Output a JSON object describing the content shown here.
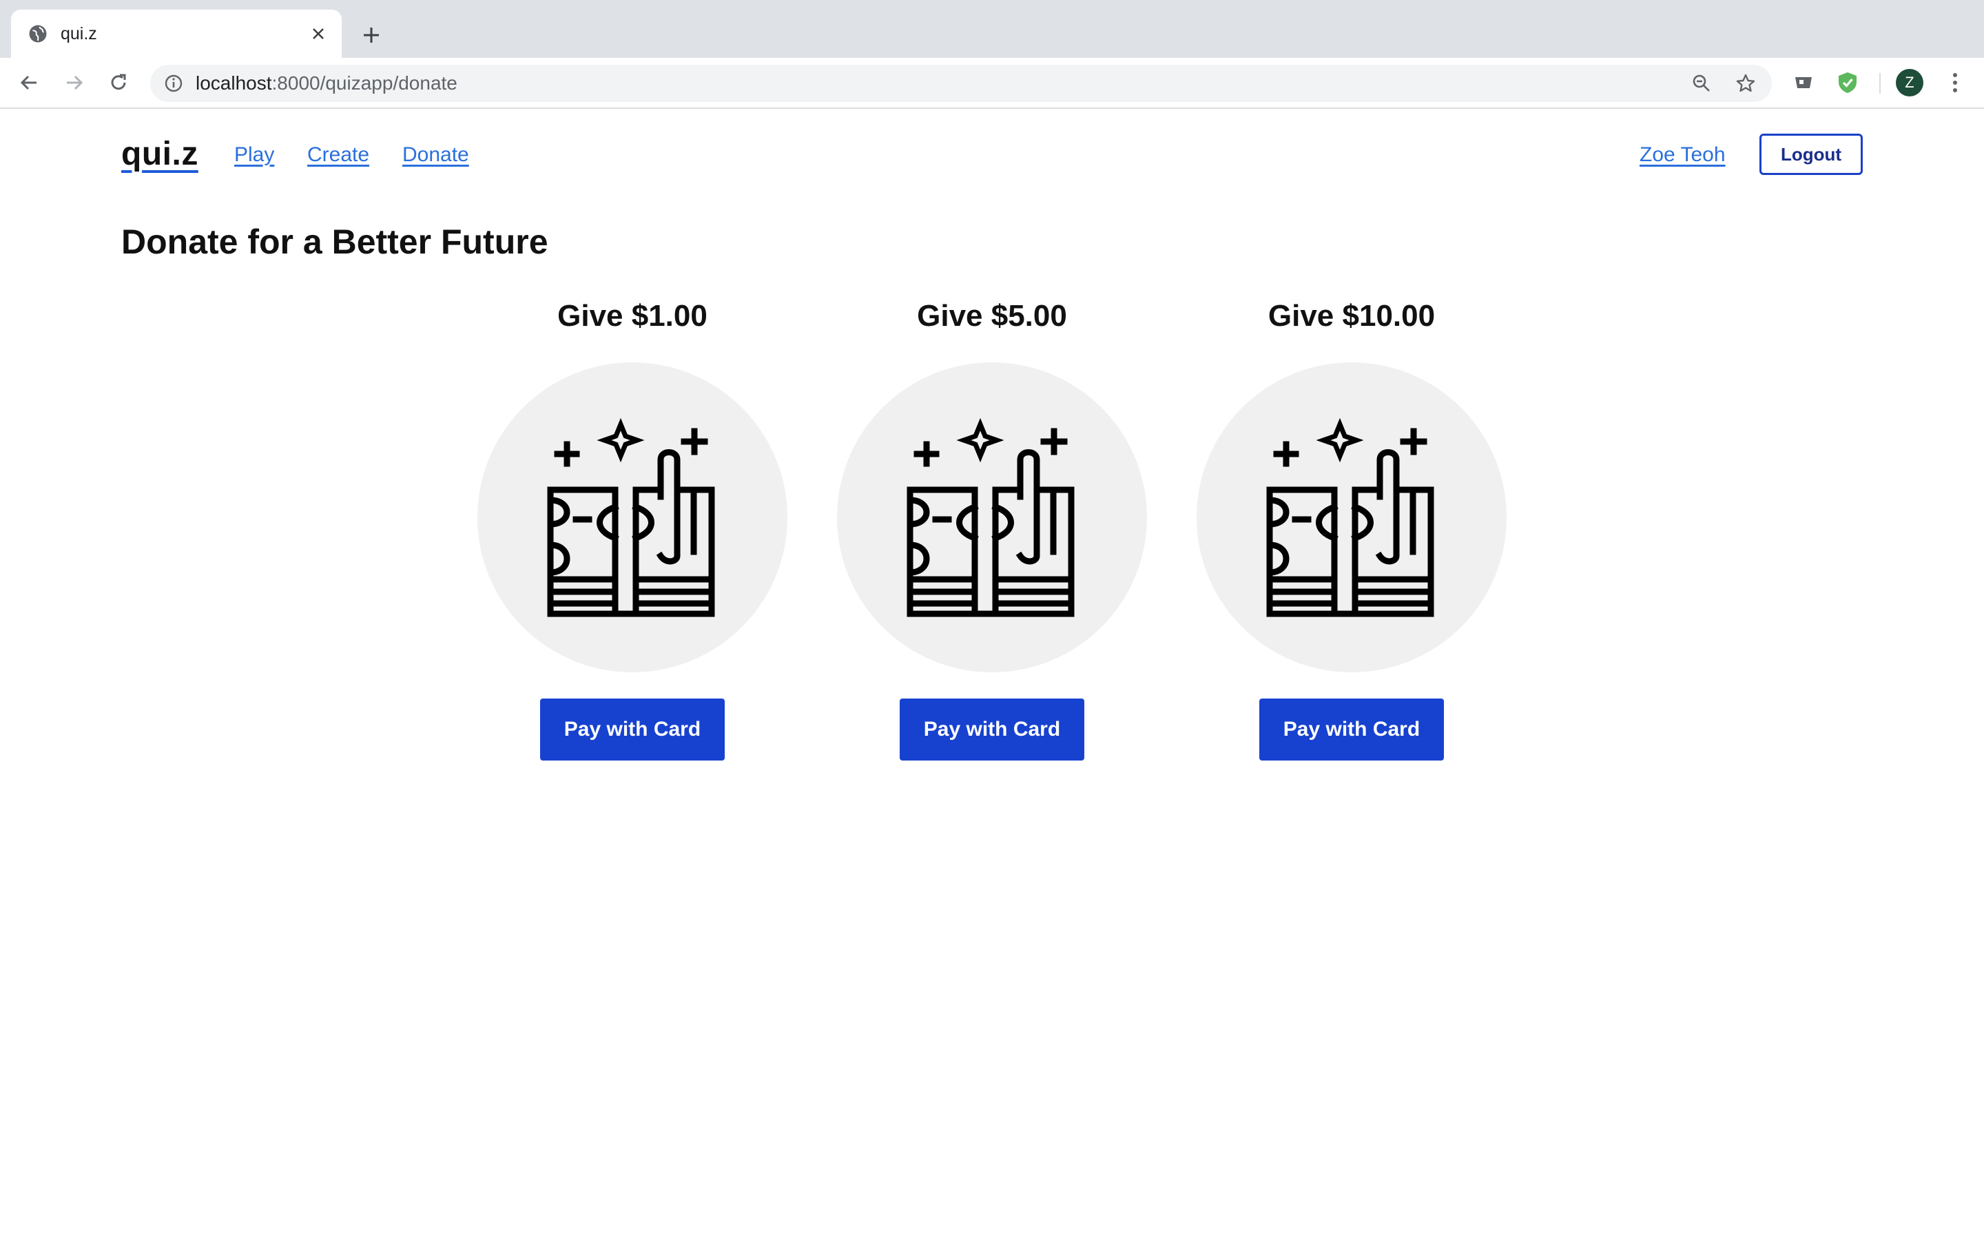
{
  "browser": {
    "tab_title": "qui.z",
    "url_host": "localhost",
    "url_rest": ":8000/quizapp/donate",
    "profile_initial": "Z",
    "icons": [
      "globe-icon",
      "close-icon",
      "plus-icon",
      "back-arrow-icon",
      "forward-arrow-icon",
      "reload-icon",
      "info-icon",
      "zoom-icon",
      "star-icon",
      "extension-icon",
      "shield-check-icon",
      "kebab-menu-icon"
    ]
  },
  "nav": {
    "brand": "qui.z",
    "links": [
      "Play",
      "Create",
      "Donate"
    ],
    "user": "Zoe Teoh",
    "logout": "Logout"
  },
  "page": {
    "title": "Donate for a Better Future",
    "donations": [
      {
        "heading": "Give $1.00",
        "button": "Pay with Card"
      },
      {
        "heading": "Give $5.00",
        "button": "Pay with Card"
      },
      {
        "heading": "Give $10.00",
        "button": "Pay with Card"
      }
    ]
  },
  "colors": {
    "primary_button": "#1742cf",
    "link": "#2a6fdc",
    "circle_bg": "#f0f0f0"
  }
}
